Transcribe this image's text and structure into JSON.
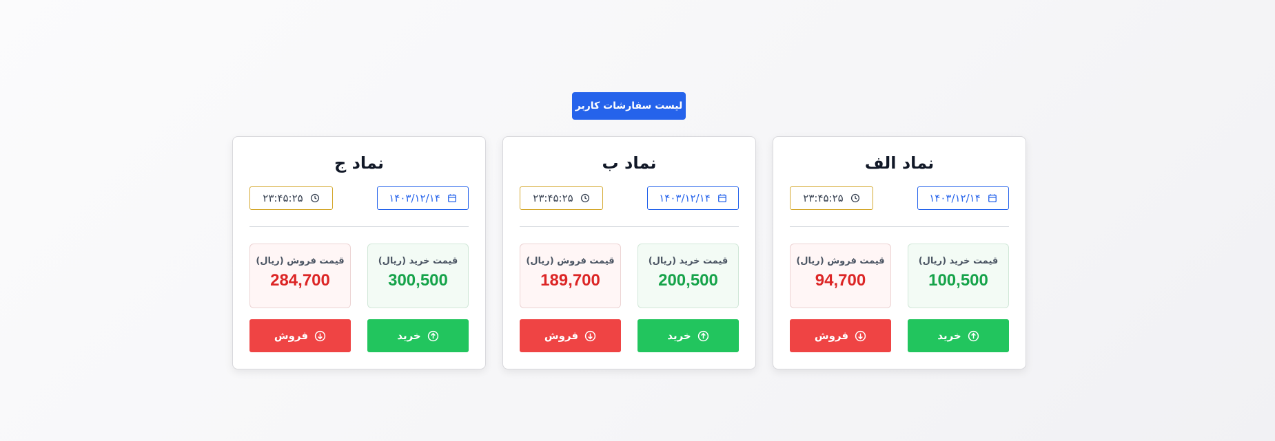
{
  "header": {
    "orders_button_label": "لیست سفارشات کاربر"
  },
  "cards": [
    {
      "title": "نماد الف",
      "date": "۱۴۰۳/۱۲/۱۴",
      "time": "۲۳:۴۵:۲۵",
      "buy_label": "قیمت خرید (ریال)",
      "buy_price": "100,500",
      "sell_label": "قیمت فروش (ریال)",
      "sell_price": "94,700",
      "buy_button": "خرید",
      "sell_button": "فروش"
    },
    {
      "title": "نماد ب",
      "date": "۱۴۰۳/۱۲/۱۴",
      "time": "۲۳:۴۵:۲۵",
      "buy_label": "قیمت خرید (ریال)",
      "buy_price": "200,500",
      "sell_label": "قیمت فروش (ریال)",
      "sell_price": "189,700",
      "buy_button": "خرید",
      "sell_button": "فروش"
    },
    {
      "title": "نماد ج",
      "date": "۱۴۰۳/۱۲/۱۴",
      "time": "۲۳:۴۵:۲۵",
      "buy_label": "قیمت خرید (ریال)",
      "buy_price": "300,500",
      "sell_label": "قیمت فروش (ریال)",
      "sell_price": "284,700",
      "buy_button": "خرید",
      "sell_button": "فروش"
    }
  ],
  "icons": {
    "date": "calendar-icon",
    "time": "clock-icon",
    "buy": "arrow-up-circle-icon",
    "sell": "arrow-down-circle-icon"
  },
  "colors": {
    "primary": "#2563eb",
    "buy": "#22c55e",
    "buy_text": "#16a34a",
    "sell": "#ef4444",
    "sell_text": "#dc2626",
    "time_border": "#d4a72c"
  }
}
